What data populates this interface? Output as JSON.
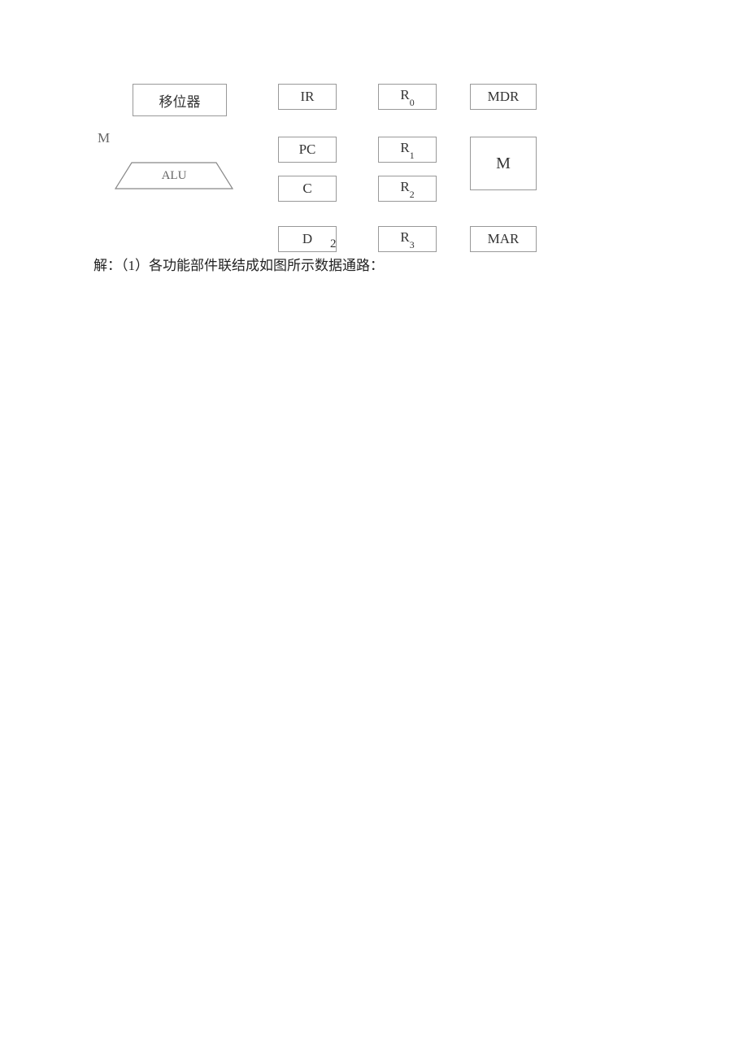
{
  "diagram": {
    "shifter": "移位器",
    "m_label": "M",
    "alu": "ALU",
    "col2": {
      "ir": "IR",
      "pc": "PC",
      "c": "C",
      "d": "D",
      "d_sub": "2"
    },
    "col3": {
      "r0_base": "R",
      "r0_sub": "0",
      "r1_base": "R",
      "r1_sub": "1",
      "r2_base": "R",
      "r2_sub": "2",
      "r3_base": "R",
      "r3_sub": "3"
    },
    "col4": {
      "mdr": "MDR",
      "mem": "M",
      "mar": "MAR"
    }
  },
  "answer_text": "解：（1）各功能部件联结成如图所示数据通路："
}
